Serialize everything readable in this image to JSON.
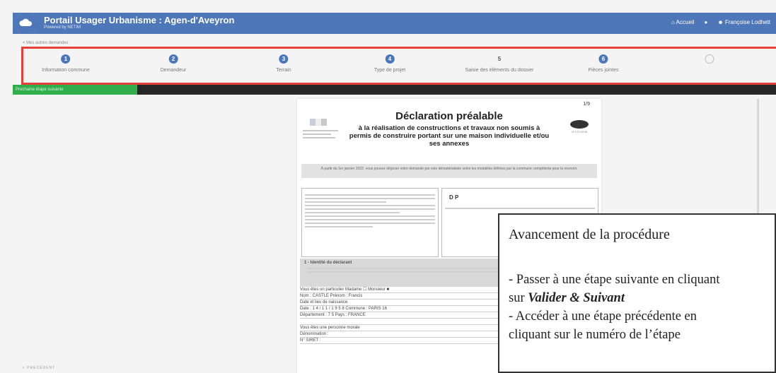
{
  "header": {
    "title": "Portail Usager Urbanisme : Agen-d'Aveyron",
    "subtitle": "Powered by NETIM",
    "links": [
      {
        "label": "Accueil"
      },
      {
        "label": ""
      },
      {
        "label": "Françoise Lodhett"
      }
    ]
  },
  "back_link": "< Mes autres demandes",
  "stepper": {
    "steps": [
      {
        "number": "1",
        "label": "Information commune"
      },
      {
        "number": "2",
        "label": "Demandeur"
      },
      {
        "number": "3",
        "label": "Terrain"
      },
      {
        "number": "4",
        "label": "Type de projet"
      },
      {
        "number": "5",
        "label": "Saisie des éléments du dossier"
      },
      {
        "number": "6",
        "label": "Pièces jointes"
      },
      {
        "number": "",
        "label": ""
      }
    ]
  },
  "progress": {
    "label": "Prochaine étape suivante",
    "fraction": 0.16
  },
  "document": {
    "page": "1/9",
    "title": "Déclaration préalable",
    "subtitle": "à la réalisation de constructions et travaux non soumis à permis de construire portant sur une maison individuelle et/ou ses annexes",
    "notice": "À partir du 1er janvier 2022, vous pouvez déposer votre demande par voie dématérialisée selon les modalités définies par la commune compétente pour la recevoir.",
    "dp_label": "D P",
    "section_title": "1 - Identité du déclarant",
    "fields": [
      "Vous êtes un particulier     Madame ☐  Monsieur ■",
      "Nom : CASTLE                         Prénom : Francis",
      "Date et lieu de naissance",
      "Date : 1 4 / 1 1 / 1 9 5 8     Commune : PARIS 16",
      "Département : 7 5               Pays : FRANCE",
      "",
      "Vous êtes une personne morale",
      "Dénomination :",
      "N° SIRET :"
    ]
  },
  "previous_label": "< PRÉCÉDENT",
  "tooltip": {
    "title": "Avancement de la procédure",
    "line1": "- Passer à une étape suivante en cliquant",
    "line2_prefix": "sur ",
    "line2_emphasis": "Valider & Suivant",
    "line3": "- Accéder à une étape précédente en",
    "line4": "cliquant sur le numéro de l’étape"
  },
  "colors": {
    "header": "#4d77b8",
    "highlight": "#e53f3a",
    "progress": "#2fae4b"
  }
}
